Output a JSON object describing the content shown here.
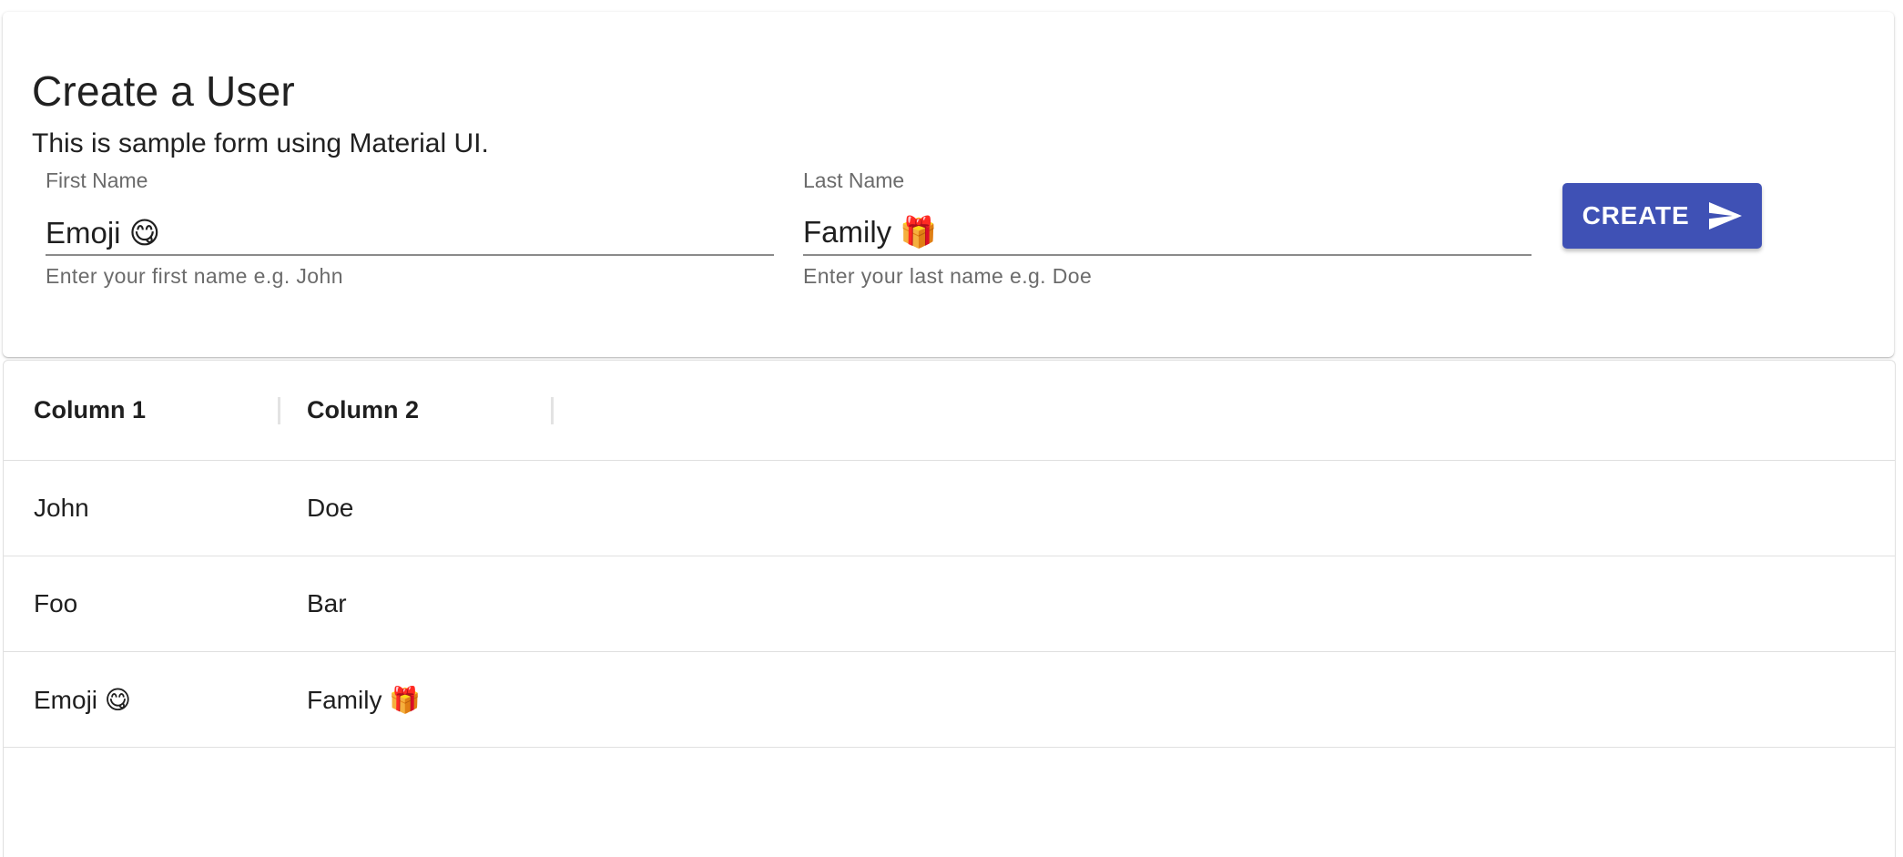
{
  "form": {
    "title": "Create a User",
    "subtitle": "This is sample form using Material UI.",
    "first_name": {
      "label": "First Name",
      "value": "Emoji 😋",
      "helper": "Enter your first name e.g. John"
    },
    "last_name": {
      "label": "Last Name",
      "value": "Family 🎁",
      "helper": "Enter your last name e.g. Doe"
    },
    "create_button": {
      "label": "CREATE",
      "icon": "send-icon"
    }
  },
  "table": {
    "columns": [
      "Column 1",
      "Column 2"
    ],
    "rows": [
      [
        "John",
        "Doe"
      ],
      [
        "Foo",
        "Bar"
      ],
      [
        "Emoji 😋",
        "Family 🎁"
      ]
    ]
  },
  "colors": {
    "primary": "#3f51b5",
    "helper_text": "#6b6b6b",
    "divider": "#e0e0e0"
  }
}
